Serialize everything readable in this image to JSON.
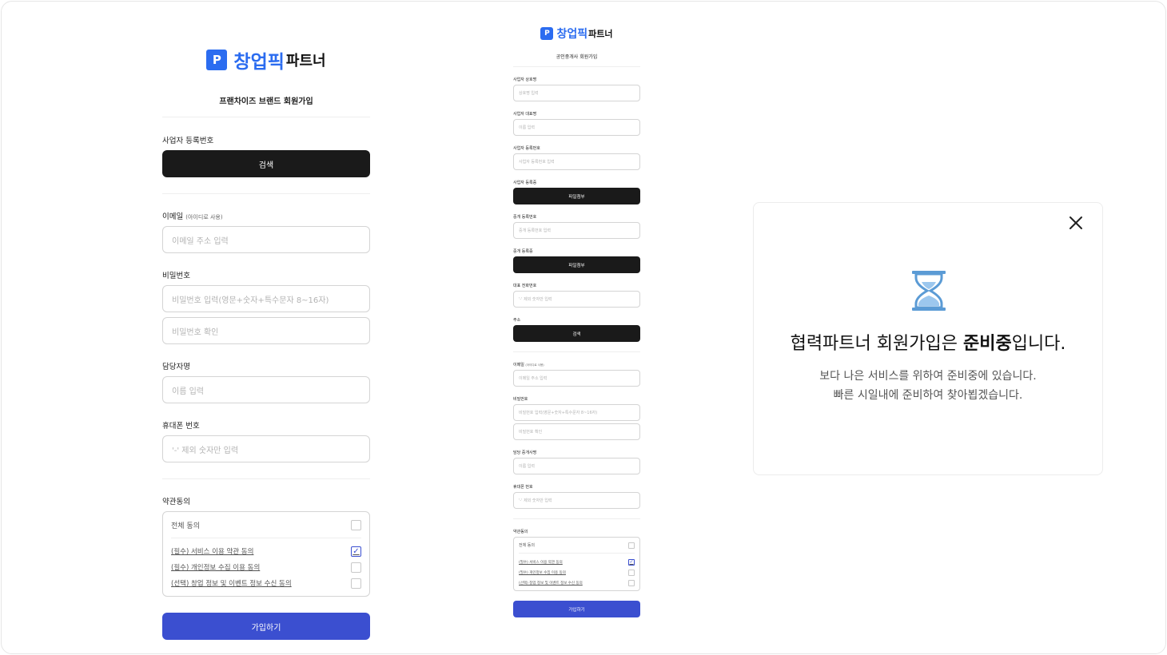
{
  "form_franchise": {
    "logo": {
      "mark": "P",
      "brand": "창업픽",
      "suffix": "파트너"
    },
    "title": "프랜차이즈 브랜드 회원가입",
    "biz_number": {
      "label": "사업자 등록번호",
      "button": "검색"
    },
    "email": {
      "label": "이메일",
      "hint": "(아이디로 사용)",
      "placeholder": "이메일 주소 입력"
    },
    "password": {
      "label": "비밀번호",
      "placeholder": "비밀번호 입력(영문+숫자+특수문자 8~16자)",
      "confirm_placeholder": "비밀번호 확인"
    },
    "manager": {
      "label": "담당자명",
      "placeholder": "이름 입력"
    },
    "phone": {
      "label": "휴대폰 번호",
      "placeholder": "'-' 제외 숫자만 입력"
    },
    "terms": {
      "label": "약관동의",
      "all": "전체 동의",
      "items": [
        {
          "text": "(필수) 서비스 이용 약관 동의",
          "checked": true
        },
        {
          "text": "(필수) 개인정보 수집 이용 동의",
          "checked": false
        },
        {
          "text": "(선택) 창업 정보 및 이벤트 정보 수신 동의",
          "checked": false
        }
      ]
    },
    "submit": "가입하기"
  },
  "form_broker": {
    "logo": {
      "mark": "P",
      "brand": "창업픽",
      "suffix": "파트너"
    },
    "title": "공인중개사 회원가입",
    "biz_name": {
      "label": "사업자 상호명",
      "placeholder": "상호명 입력"
    },
    "biz_rep": {
      "label": "사업자 대표명",
      "placeholder": "이름 입력"
    },
    "biz_number": {
      "label": "사업자 등록번호",
      "placeholder": "사업자 등록번호 입력"
    },
    "biz_cert": {
      "label": "사업자 등록증",
      "button": "파일첨부"
    },
    "broker_number": {
      "label": "중개 등록번호",
      "placeholder": "중개 등록번호 입력"
    },
    "broker_cert": {
      "label": "중개 등록증",
      "button": "파일첨부"
    },
    "rep_phone": {
      "label": "대표 전화번호",
      "placeholder": "'-' 제외 숫자만 입력"
    },
    "address": {
      "label": "주소",
      "button": "검색"
    },
    "email": {
      "label": "이메일",
      "hint": "(아이디로 사용)",
      "placeholder": "이메일 주소 입력"
    },
    "password": {
      "label": "비밀번호",
      "placeholder": "비밀번호 입력(영문+숫자+특수문자 8~16자)",
      "confirm_placeholder": "비밀번호 확인"
    },
    "agent": {
      "label": "담당 중개사명",
      "placeholder": "이름 입력"
    },
    "phone": {
      "label": "휴대폰 번호",
      "placeholder": "'-' 제외 숫자만 입력"
    },
    "terms": {
      "label": "약관동의",
      "all": "전체 동의",
      "items": [
        {
          "text": "(필수) 서비스 이용 약관 동의",
          "checked": true
        },
        {
          "text": "(필수) 개인정보 수집 이용 동의",
          "checked": false
        },
        {
          "text": "(선택) 창업 정보 및 이벤트 정보 수신 동의",
          "checked": false
        }
      ]
    },
    "submit": "가입하기"
  },
  "modal": {
    "title_prefix": "협력파트너 회원가입은 ",
    "title_bold": "준비중",
    "title_suffix": "입니다.",
    "desc_line1": "보다 나은 서비스를 위하여 준비중에 있습니다.",
    "desc_line2": "빠른 시일내에 준비하여 찾아뵙겠습니다.",
    "icon": "hourglass-icon",
    "close_icon": "close-icon"
  },
  "colors": {
    "accent": "#3b4fd0",
    "brand_blue": "#2b6cf0",
    "dark_button": "#1a1a1a",
    "hourglass": "#5b9bd5"
  }
}
